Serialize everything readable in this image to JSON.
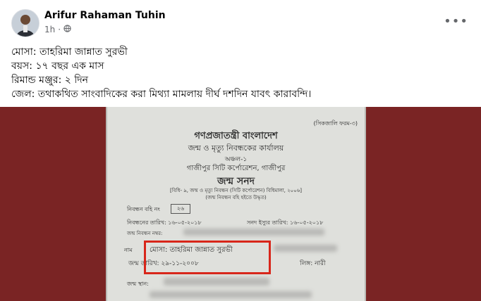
{
  "author": {
    "name": "Arifur Rahaman Tuhin",
    "time": "1h"
  },
  "post": {
    "lines": [
      "মোসা: তাহরিমা জান্নাত সুরভী",
      "বয়স: ১৭ বছর এক মাস",
      "রিমান্ড মঞ্জুর: ২ দিন",
      "জেল: তথাকথিত সাংবাদিকের করা মিথ্যা মামলায় দীর্ঘ দশদিন যাবৎ কারাবন্দি।"
    ]
  },
  "certificate": {
    "form_no": "(সিকজালি ফরম-৩)",
    "country": "গণপ্রজাতন্ত্রী বাংলাদেশ",
    "office": "জন্ম ও মৃত্যু নিবন্ধকের কার্যালয়",
    "zone": "অঞ্চল-১",
    "corp": "গাজীপুর সিটি কর্পোরেশন, গাজীপুর",
    "title": "জন্ম সনদ",
    "rule": "[বিধি- ৯, জন্ম ও মৃত্যু নিবন্ধন (সিটি কর্পোরেশন) বিধিমালা, ২০০৬]",
    "rule2": "(জন্ম নিবন্ধন বহি হইতে উদ্ধৃত)",
    "book_label": "নিবন্ধন বহি নং",
    "book_no": "২৬",
    "reg_date": "নিবন্ধনের তারিখ: ১৬-০৫-২০১৮",
    "issue_date": "সনদ ইস্যুর তারিখ: ১৬-০৫-২০১৮",
    "reg_no_label": "জন্ম নিবন্ধন নম্বর:",
    "name_label": "নাম",
    "name": "মোসা: তাহরিমা জান্নাত সুরভী",
    "dob": "জন্ম তারিখ: ২৯-১১-২০০৮",
    "gender": "লিঙ্গ: নারী",
    "birthplace": "জন্ম স্থান:"
  },
  "colors": {
    "photo_bg": "#7a2424",
    "highlight": "#d8261a"
  }
}
